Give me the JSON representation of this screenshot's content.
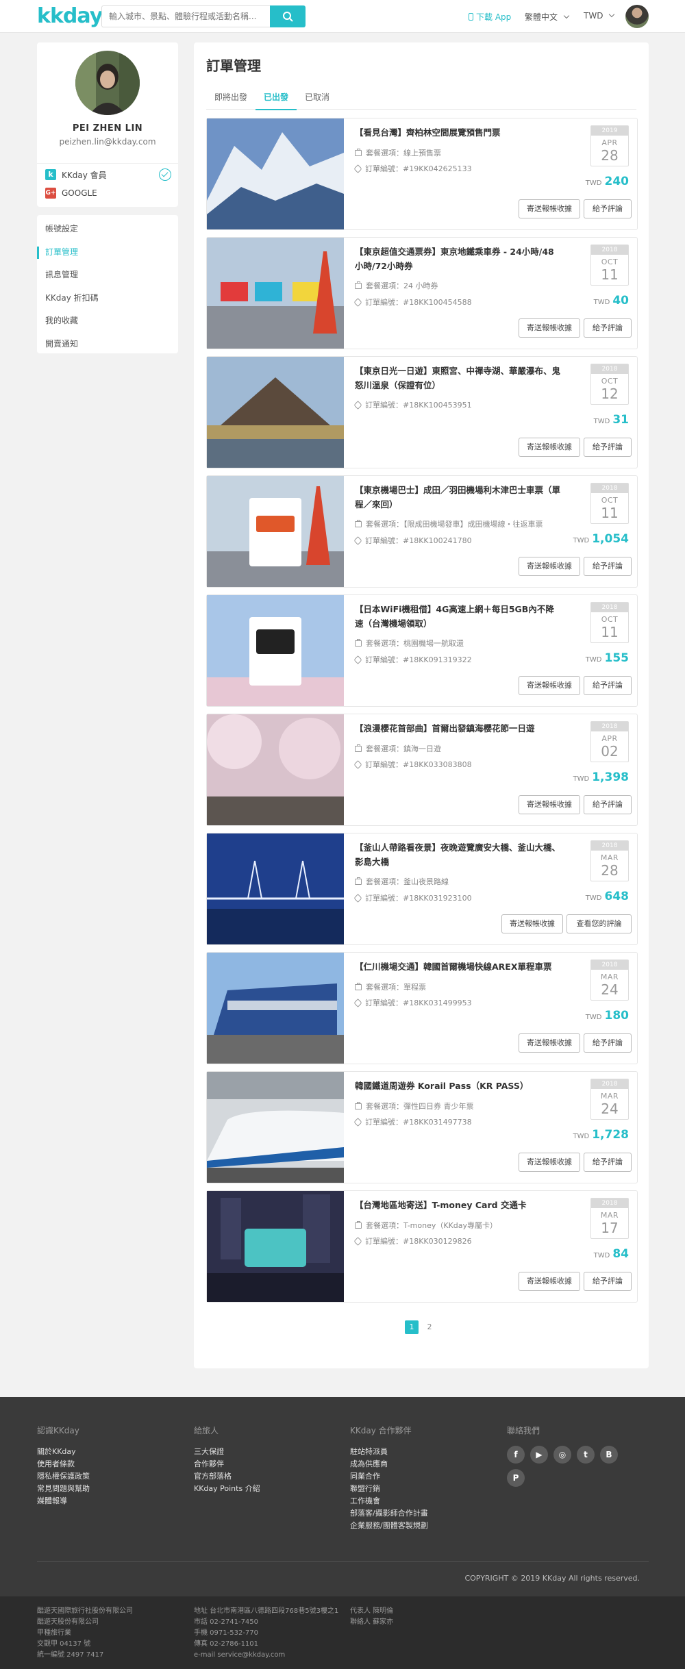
{
  "header": {
    "logo": "kkday",
    "search_placeholder": "輸入城市、景點、體驗行程或活動名稱...",
    "app_download": "下載 App",
    "language": "繁體中文",
    "currency": "TWD"
  },
  "profile": {
    "name": "PEI ZHEN LIN",
    "email": "peizhen.lin@kkday.com",
    "kkday_member": "KKday 會員",
    "google": "GOOGLE"
  },
  "side_menu": [
    {
      "label": "帳號設定"
    },
    {
      "label": "訂單管理"
    },
    {
      "label": "訊息管理"
    },
    {
      "label": "KKday 折扣碼"
    },
    {
      "label": "我的收藏"
    },
    {
      "label": "開賣通知"
    }
  ],
  "main": {
    "title": "訂單管理",
    "tabs": [
      {
        "label": "即將出發"
      },
      {
        "label": "已出發"
      },
      {
        "label": "已取消"
      }
    ],
    "orders": [
      {
        "title": "【看見台灣】齊柏林空間展覽預售門票",
        "package": "套餐選項：線上預售票",
        "order_no": "訂單編號：#19KK042625133",
        "year": "2019",
        "month": "APR",
        "day": "28",
        "currency": "TWD",
        "price": "240",
        "voucher": "寄送報帳收據",
        "review": "給予評論"
      },
      {
        "title": "【東京超值交通票券】東京地鐵乘車券 - 24小時/48小時/72小時券",
        "package": "套餐選項：24 小時券",
        "order_no": "訂單編號：#18KK100454588",
        "year": "2018",
        "month": "OCT",
        "day": "11",
        "currency": "TWD",
        "price": "40",
        "voucher": "寄送報帳收據",
        "review": "給予評論"
      },
      {
        "title": "【東京日光一日遊】東照宮、中禪寺湖、華嚴瀑布、鬼怒川溫泉（保證有位）",
        "package": "",
        "order_no": "訂單編號：#18KK100453951",
        "year": "2018",
        "month": "OCT",
        "day": "12",
        "currency": "TWD",
        "price": "31",
        "voucher": "寄送報帳收據",
        "review": "給予評論"
      },
      {
        "title": "【東京機場巴士】成田／羽田機場利木津巴士車票（單程／來回）",
        "package": "套餐選項：【限成田機場發車】成田機場線・往返車票",
        "order_no": "訂單編號：#18KK100241780",
        "year": "2018",
        "month": "OCT",
        "day": "11",
        "currency": "TWD",
        "price": "1,054",
        "voucher": "寄送報帳收據",
        "review": "給予評論"
      },
      {
        "title": "【日本WiFi機租借】4G高速上網＋每日5GB內不降速（台灣機場領取）",
        "package": "套餐選項：桃園機場一航取還",
        "order_no": "訂單編號：#18KK091319322",
        "year": "2018",
        "month": "OCT",
        "day": "11",
        "currency": "TWD",
        "price": "155",
        "voucher": "寄送報帳收據",
        "review": "給予評論"
      },
      {
        "title": "【浪漫櫻花首部曲】首爾出發鎮海櫻花節一日遊",
        "package": "套餐選項：鎮海一日遊",
        "order_no": "訂單編號：#18KK033083808",
        "year": "2018",
        "month": "APR",
        "day": "02",
        "currency": "TWD",
        "price": "1,398",
        "voucher": "寄送報帳收據",
        "review": "給予評論"
      },
      {
        "title": "【釜山人帶路看夜景】夜晚遊覽廣安大橋、釜山大橋、影島大橋",
        "package": "套餐選項：釜山夜景路線",
        "order_no": "訂單編號：#18KK031923100",
        "year": "2018",
        "month": "MAR",
        "day": "28",
        "currency": "TWD",
        "price": "648",
        "voucher": "寄送報帳收據",
        "review": "查看您的評論"
      },
      {
        "title": "【仁川機場交通】韓國首爾機場快線AREX單程車票",
        "package": "套餐選項：單程票",
        "order_no": "訂單編號：#18KK031499953",
        "year": "2018",
        "month": "MAR",
        "day": "24",
        "currency": "TWD",
        "price": "180",
        "voucher": "寄送報帳收據",
        "review": "給予評論"
      },
      {
        "title": "韓國鐵道周遊券 Korail Pass（KR PASS）",
        "package": "套餐選項：彈性四日券 青少年票",
        "order_no": "訂單編號：#18KK031497738",
        "year": "2018",
        "month": "MAR",
        "day": "24",
        "currency": "TWD",
        "price": "1,728",
        "voucher": "寄送報帳收據",
        "review": "給予評論"
      },
      {
        "title": "【台灣地區地寄送】T-money Card 交通卡",
        "package": "套餐選項：T-money（KKday專屬卡）",
        "order_no": "訂單編號：#18KK030129826",
        "year": "2018",
        "month": "MAR",
        "day": "17",
        "currency": "TWD",
        "price": "84",
        "voucher": "寄送報帳收據",
        "review": "給予評論"
      }
    ],
    "pagination": [
      "1",
      "2"
    ]
  },
  "footer": {
    "col1": {
      "head": "認識KKday",
      "links": [
        "關於KKday",
        "使用者條款",
        "隱私權保護政策",
        "常見問題與幫助",
        "媒體報導"
      ]
    },
    "col2": {
      "head": "給旅人",
      "links": [
        "三大保證",
        "合作夥伴",
        "官方部落格",
        "KKday Points 介紹"
      ]
    },
    "col3": {
      "head": "KKday 合作夥伴",
      "links": [
        "駐站特派員",
        "成為供應商",
        "同業合作",
        "聯盟行銷",
        "工作機會",
        "部落客/攝影師合作計畫",
        "企業服務/團體客製規劃"
      ]
    },
    "col4": {
      "head": "聯絡我們",
      "social": [
        "f",
        "▶",
        "◎",
        "t",
        "B",
        "P"
      ]
    },
    "copyright": "COPYRIGHT © 2019 KKday All rights reserved.",
    "legal1": [
      "酷遊天國際旅行社股份有限公司",
      "酷遊天股份有限公司",
      "甲種旅行業",
      "交觀甲 04137 號",
      "統一編號 2497 7417"
    ],
    "legal2": [
      "地址 台北市南港區八德路四段768巷5號3樓之1",
      "市話 02-2741-7450",
      "手機 0971-532-770",
      "傳真 02-2786-1101",
      "e-mail service@kkday.com"
    ],
    "legal3": [
      "代表人 陳明倫",
      "聯絡人 蘇家亦"
    ]
  }
}
